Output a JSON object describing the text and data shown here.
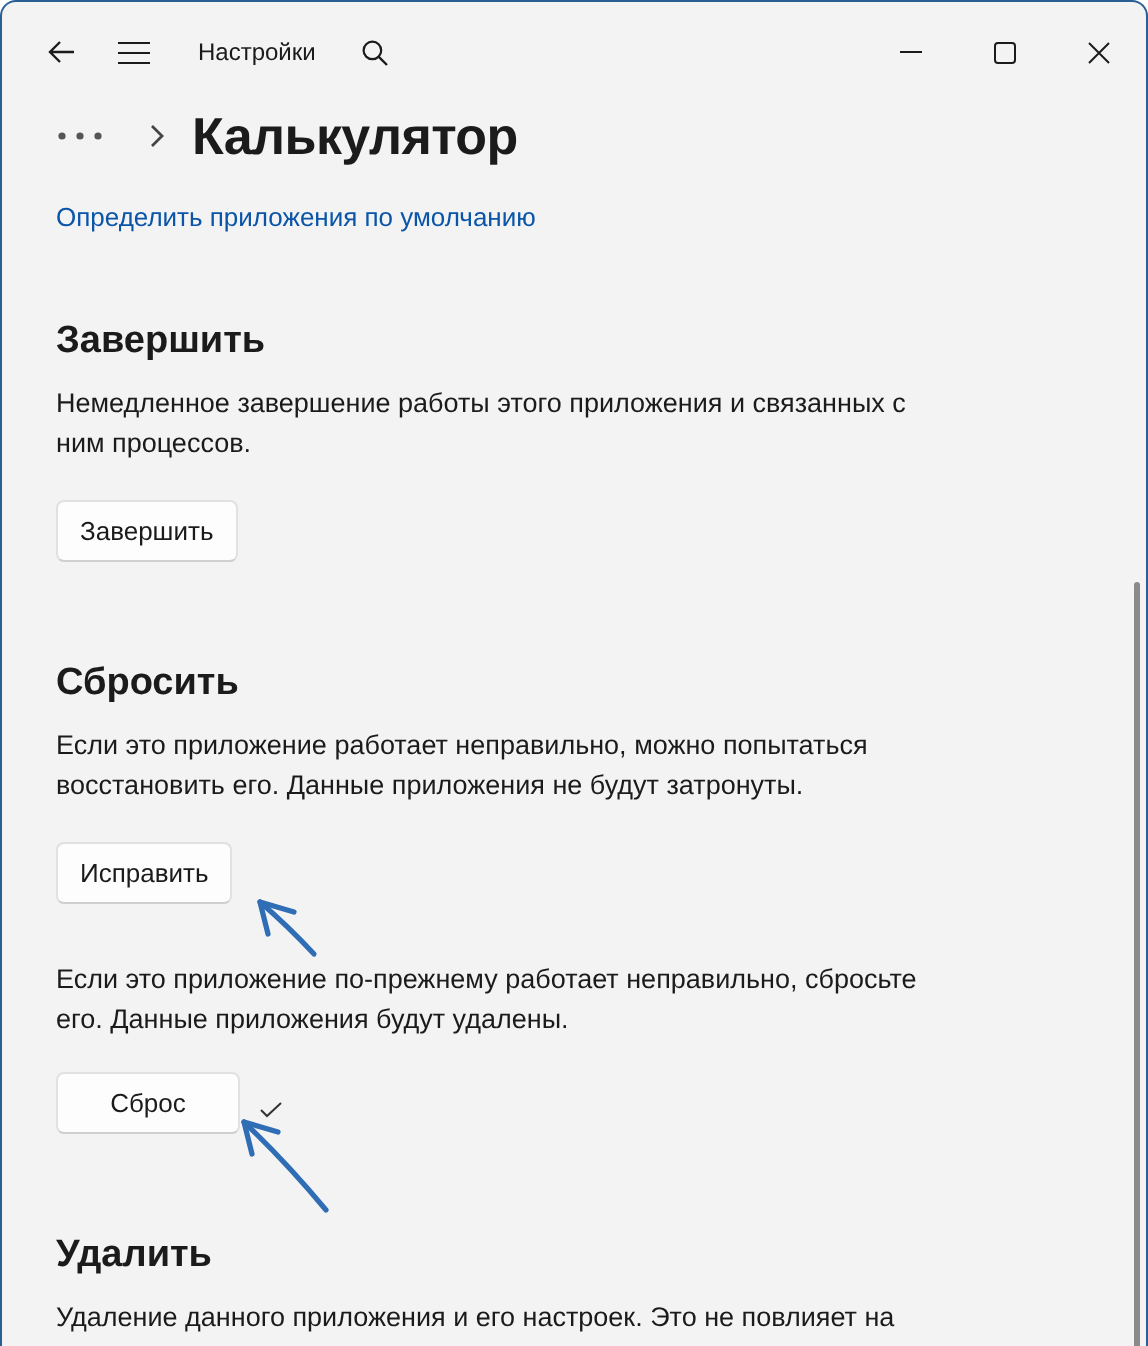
{
  "window": {
    "title": "Настройки"
  },
  "breadcrumb": {
    "title": "Калькулятор"
  },
  "link": "Определить приложения по умолчанию",
  "sections": [
    {
      "heading": "Завершить",
      "blocks": [
        {
          "text": "Немедленное завершение работы этого приложения и связанных с ним процессов.",
          "button": "Завершить",
          "done": false
        }
      ]
    },
    {
      "heading": "Сбросить",
      "blocks": [
        {
          "text": "Если это приложение работает неправильно, можно попытаться восстановить его. Данные приложения не будут затронуты.",
          "button": "Исправить",
          "done": false
        },
        {
          "text": "Если это приложение по-прежнему работает неправильно, сбросьте его. Данные приложения будут удалены.",
          "button": "Сброс",
          "done": true
        }
      ]
    },
    {
      "heading": "Удалить",
      "blocks": [
        {
          "text": "Удаление данного приложения и его настроек. Это не повлияет на"
        }
      ]
    }
  ]
}
